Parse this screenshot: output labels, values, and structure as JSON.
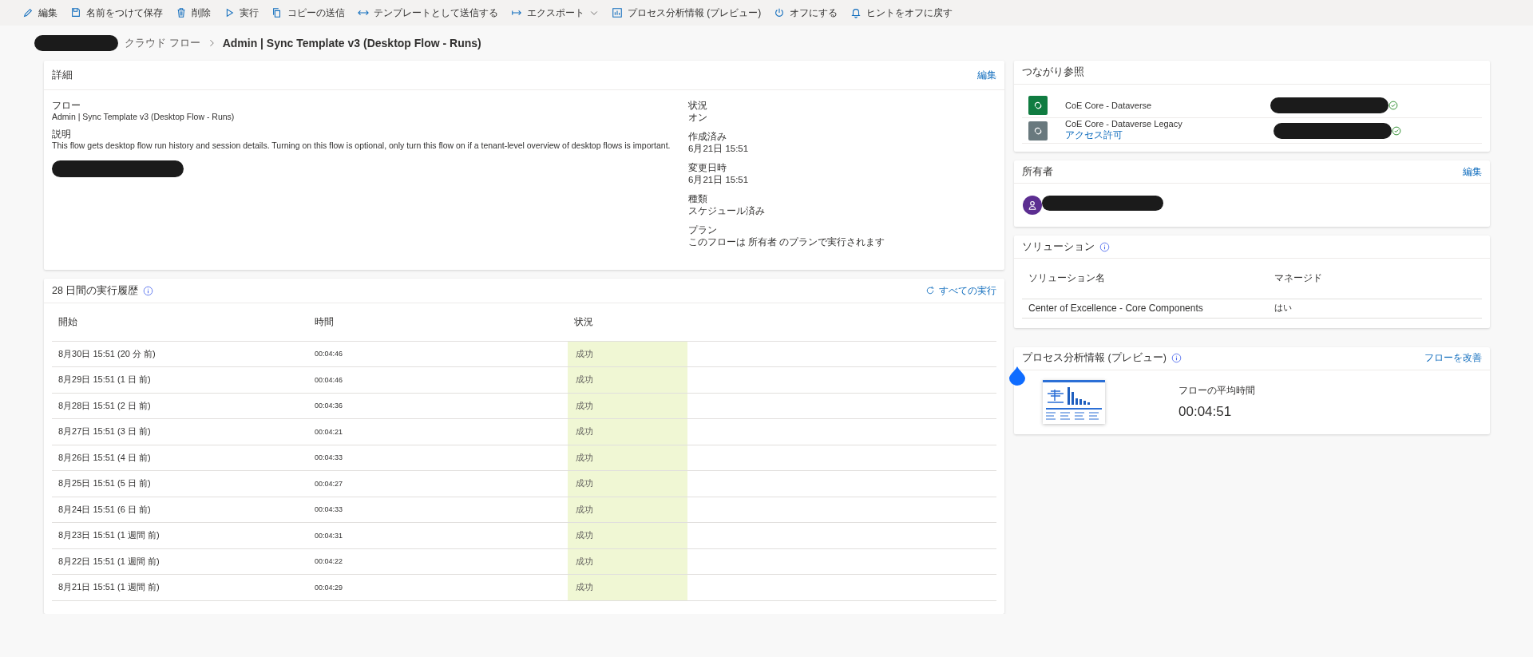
{
  "toolbar": [
    {
      "label": "編集"
    },
    {
      "label": "名前をつけて保存"
    },
    {
      "label": "削除"
    },
    {
      "label": "実行"
    },
    {
      "label": "コピーの送信"
    },
    {
      "label": "テンプレートとして送信する"
    },
    {
      "label": "エクスポート",
      "dropdown": true
    },
    {
      "label": "プロセス分析情報 (プレビュー)"
    },
    {
      "label": "オフにする"
    },
    {
      "label": "ヒントをオフに戻す"
    }
  ],
  "breadcrumb": {
    "parent": "クラウド フロー",
    "current": "Admin | Sync Template v3 (Desktop Flow - Runs)"
  },
  "details": {
    "title": "詳細",
    "edit": "編集",
    "left_fields": [
      {
        "label": "フロー",
        "value": "Admin | Sync Template v3 (Desktop Flow - Runs)"
      },
      {
        "label": "説明",
        "value": "This flow gets desktop flow run history and session details. Turning on this flow is optional, only turn this flow on if a tenant-level overview of desktop flows is important."
      }
    ],
    "right_fields": [
      {
        "label": "状況",
        "value": "オン"
      },
      {
        "label": "作成済み",
        "value": "6月21日 15:51"
      },
      {
        "label": "変更日時",
        "value": "6月21日 15:51"
      },
      {
        "label": "種類",
        "value": "スケジュール済み"
      },
      {
        "label": "プラン",
        "value": "このフローは 所有者 のプランで実行されます"
      }
    ]
  },
  "run_history": {
    "title": "28 日間の実行履歴",
    "all_runs": "すべての実行",
    "columns": [
      "開始",
      "時間",
      "状況"
    ],
    "rows": [
      {
        "start": "8月30日 15:51 (20 分 前)",
        "duration": "00:04:46",
        "status": "成功"
      },
      {
        "start": "8月29日 15:51 (1 日 前)",
        "duration": "00:04:46",
        "status": "成功"
      },
      {
        "start": "8月28日 15:51 (2 日 前)",
        "duration": "00:04:36",
        "status": "成功"
      },
      {
        "start": "8月27日 15:51 (3 日 前)",
        "duration": "00:04:21",
        "status": "成功"
      },
      {
        "start": "8月26日 15:51 (4 日 前)",
        "duration": "00:04:33",
        "status": "成功"
      },
      {
        "start": "8月25日 15:51 (5 日 前)",
        "duration": "00:04:27",
        "status": "成功"
      },
      {
        "start": "8月24日 15:51 (6 日 前)",
        "duration": "00:04:33",
        "status": "成功"
      },
      {
        "start": "8月23日 15:51 (1 週間 前)",
        "duration": "00:04:31",
        "status": "成功"
      },
      {
        "start": "8月22日 15:51 (1 週間 前)",
        "duration": "00:04:22",
        "status": "成功"
      },
      {
        "start": "8月21日 15:51 (1 週間 前)",
        "duration": "00:04:29",
        "status": "成功"
      }
    ]
  },
  "connections": {
    "title": "つながり参照",
    "items": [
      {
        "name": "CoE Core - Dataverse",
        "color": "#107c41",
        "connected": true
      },
      {
        "name": "CoE Core - Dataverse Legacy",
        "color": "#69797e",
        "link": "アクセス許可",
        "connected": true
      }
    ]
  },
  "owners": {
    "title": "所有者",
    "edit": "編集"
  },
  "solutions": {
    "title": "ソリューション",
    "columns": [
      "ソリューション名",
      "マネージド"
    ],
    "rows": [
      [
        "Center of Excellence - Core Components",
        "はい"
      ]
    ]
  },
  "process_insights": {
    "title": "プロセス分析情報 (プレビュー)",
    "link": "フローを改善",
    "metric_label": "フローの平均時間",
    "metric_value": "00:04:51"
  }
}
